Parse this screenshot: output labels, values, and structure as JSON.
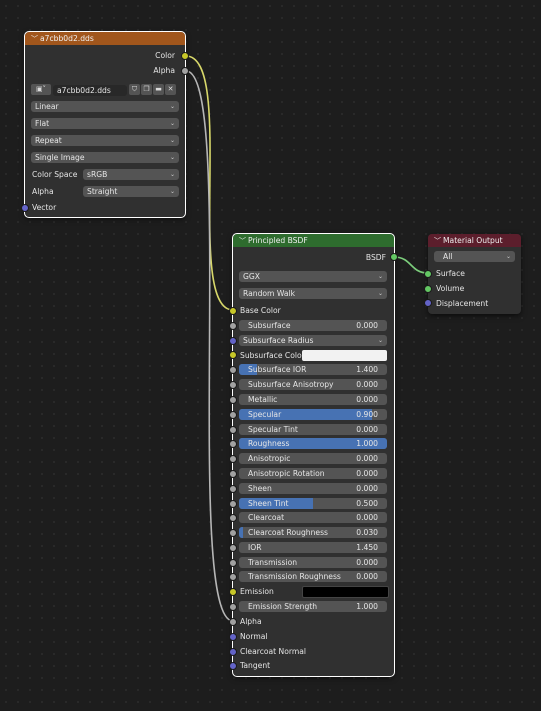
{
  "colors": {
    "image_header": "#a1561c",
    "bsdf_header": "#2e6c2e",
    "output_header": "#5c1e2c",
    "wire_color": "#d8d86a",
    "wire_shader": "#7cce7c",
    "wire_gray": "#b6b6b6",
    "slider_fill": "#4772b3"
  },
  "image_node": {
    "title": "a7cbb0d2.dds",
    "outputs": {
      "color": "Color",
      "alpha": "Alpha"
    },
    "image_name": "a7cbb0d2.dds",
    "image_browse_icon": "image-icon",
    "interpolation": "Linear",
    "projection": "Flat",
    "extension": "Repeat",
    "source": "Single Image",
    "color_space_label": "Color Space",
    "color_space": "sRGB",
    "alpha_label": "Alpha",
    "alpha_mode": "Straight",
    "vector_label": "Vector"
  },
  "bsdf_node": {
    "title": "Principled BSDF",
    "output": "BSDF",
    "distribution": "GGX",
    "subsurface_method": "Random Walk",
    "base_color_label": "Base Color",
    "subsurface_radius_label": "Subsurface Radius",
    "subsurface_color_label": "Subsurface Color",
    "emission_label": "Emission",
    "alpha_label": "Alpha",
    "normal_label": "Normal",
    "clearcoat_normal_label": "Clearcoat Normal",
    "tangent_label": "Tangent",
    "sliders": [
      {
        "label": "Subsurface",
        "value": "0.000",
        "fill": 0
      },
      {
        "label": "Subsurface IOR",
        "value": "1.400",
        "fill": 0.12
      },
      {
        "label": "Subsurface Anisotropy",
        "value": "0.000",
        "fill": 0
      },
      {
        "label": "Metallic",
        "value": "0.000",
        "fill": 0
      },
      {
        "label": "Specular",
        "value": "0.900",
        "fill": 0.9
      },
      {
        "label": "Specular Tint",
        "value": "0.000",
        "fill": 0
      },
      {
        "label": "Roughness",
        "value": "1.000",
        "fill": 1.0
      },
      {
        "label": "Anisotropic",
        "value": "0.000",
        "fill": 0
      },
      {
        "label": "Anisotropic Rotation",
        "value": "0.000",
        "fill": 0
      },
      {
        "label": "Sheen",
        "value": "0.000",
        "fill": 0
      },
      {
        "label": "Sheen Tint",
        "value": "0.500",
        "fill": 0.5
      },
      {
        "label": "Clearcoat",
        "value": "0.000",
        "fill": 0
      },
      {
        "label": "Clearcoat Roughness",
        "value": "0.030",
        "fill": 0.03
      },
      {
        "label": "IOR",
        "value": "1.450",
        "fill": 0
      },
      {
        "label": "Transmission",
        "value": "0.000",
        "fill": 0
      },
      {
        "label": "Transmission Roughness",
        "value": "0.000",
        "fill": 0
      }
    ],
    "emission_strength": {
      "label": "Emission Strength",
      "value": "1.000"
    },
    "subsurface_color_swatch": "#f2f2f2",
    "emission_swatch": "#000000"
  },
  "output_node": {
    "title": "Material Output",
    "target": "All",
    "surface_label": "Surface",
    "volume_label": "Volume",
    "displacement_label": "Displacement"
  }
}
